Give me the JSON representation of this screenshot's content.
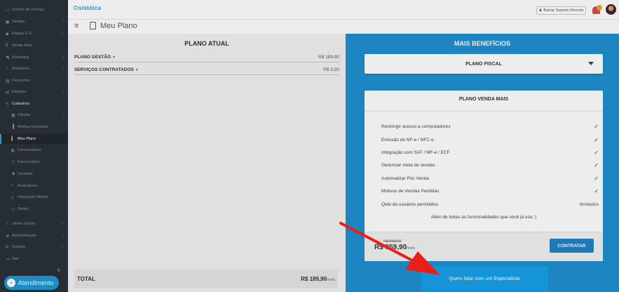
{
  "sidebar": {
    "items": [
      {
        "label": "Ordens de Serviço",
        "icon": "ordens-icon",
        "glyph": "▭",
        "chev": ""
      },
      {
        "label": "Vendas",
        "icon": "cart-icon",
        "glyph": "▣",
        "chev": "›"
      },
      {
        "label": "Etapas O.S.",
        "icon": "tags-icon",
        "glyph": "◆",
        "chev": "›"
      },
      {
        "label": "Venda Mais",
        "icon": "dollar-icon",
        "glyph": "$",
        "chev": "›"
      },
      {
        "label": "Marketing",
        "icon": "megaphone-icon",
        "glyph": "◥",
        "chev": "›"
      },
      {
        "label": "Relatórios",
        "icon": "report-icon",
        "glyph": "◔",
        "chev": "›"
      },
      {
        "label": "Financeiro",
        "icon": "money-icon",
        "glyph": "▤",
        "chev": "›"
      },
      {
        "label": "Estoque",
        "icon": "exchange-icon",
        "glyph": "⇄",
        "chev": "›"
      },
      {
        "label": "Cadastros",
        "icon": "edit-icon",
        "glyph": "✎",
        "chev": "⌄"
      },
      {
        "label": "Tabelas",
        "icon": "table-icon",
        "glyph": "▦",
        "chev": "›"
      },
      {
        "label": "Minhas Empresas",
        "icon": "building-icon",
        "glyph": "▐",
        "chev": ""
      },
      {
        "label": "Meu Plano",
        "icon": "file-icon",
        "glyph": "▌",
        "chev": ""
      },
      {
        "label": "Fornecedores",
        "icon": "truck-icon",
        "glyph": "◧",
        "chev": ""
      },
      {
        "label": "Funcionários",
        "icon": "users-icon",
        "glyph": "☺",
        "chev": ""
      },
      {
        "label": "Usuários",
        "icon": "user-group-icon",
        "glyph": "☻",
        "chev": ""
      },
      {
        "label": "Assinaturas",
        "icon": "signature-icon",
        "glyph": "≈",
        "chev": ""
      },
      {
        "label": "Integração Mobile",
        "icon": "mobile-icon",
        "glyph": "▯",
        "chev": ""
      },
      {
        "label": "Redes",
        "icon": "network-icon",
        "glyph": "⚇",
        "chev": ""
      },
      {
        "label": "Vitrine Online",
        "icon": "storefront-icon",
        "glyph": "⌂",
        "chev": "›"
      },
      {
        "label": "Administração",
        "icon": "cogs-icon",
        "glyph": "⚙",
        "chev": "›"
      },
      {
        "label": "Suporte",
        "icon": "support-icon",
        "glyph": "◘",
        "chev": "›"
      },
      {
        "label": "Sair",
        "icon": "logout-icon",
        "glyph": "⇥",
        "chev": ""
      }
    ],
    "atendimento_label": "Atendimento"
  },
  "topbar": {
    "logo_text": "sistóica",
    "suporte_label": "Baixar Suporte Remoto"
  },
  "page": {
    "title": "Meu Plano"
  },
  "plano_atual": {
    "heading": "PLANO ATUAL",
    "rows": [
      {
        "name": "PLANO GESTÃO",
        "price": "R$ 189,90"
      },
      {
        "name": "SERVIÇOS CONTRATADOS",
        "price": "R$ 0,00"
      }
    ],
    "total_label": "TOTAL",
    "total_value": "R$ 189,90",
    "total_unit": "/mês"
  },
  "beneficios": {
    "heading": "MAIS BENEFÍCIOS",
    "fiscal_label": "PLANO FISCAL",
    "card_title": "PLANO VENDA MAIS",
    "features": [
      {
        "label": "Restringir acesso a computadores",
        "value": "✓"
      },
      {
        "label": "Emissão de NF-e / NFC-e",
        "value": "✓"
      },
      {
        "label": "Integração com SAT / MF-e / ECF",
        "value": "✓"
      },
      {
        "label": "Gerenciar meta de vendas",
        "value": "✓"
      },
      {
        "label": "Automatizar Pós Venda",
        "value": "✓"
      },
      {
        "label": "Motivos de Vendas Perdidas",
        "value": "✓"
      },
      {
        "label": "Qtde de usuários permitidos",
        "value": "Ilimitados"
      }
    ],
    "note": "Além de todas as funcionalidades que você já usa :)",
    "old_price": "R$ 390,00",
    "new_price": "R$ 359,90",
    "new_price_unit": "/mês",
    "contratar_label": "CONTRATAR",
    "especialista_label": "Quero falar com um Especialista"
  },
  "colors": {
    "sidebar_bg": "#2b3138",
    "accent_blue": "#2091d0",
    "button_blue": "#18a0ea",
    "check_green": "#3fa34d",
    "arrow_red": "#e8201a"
  }
}
